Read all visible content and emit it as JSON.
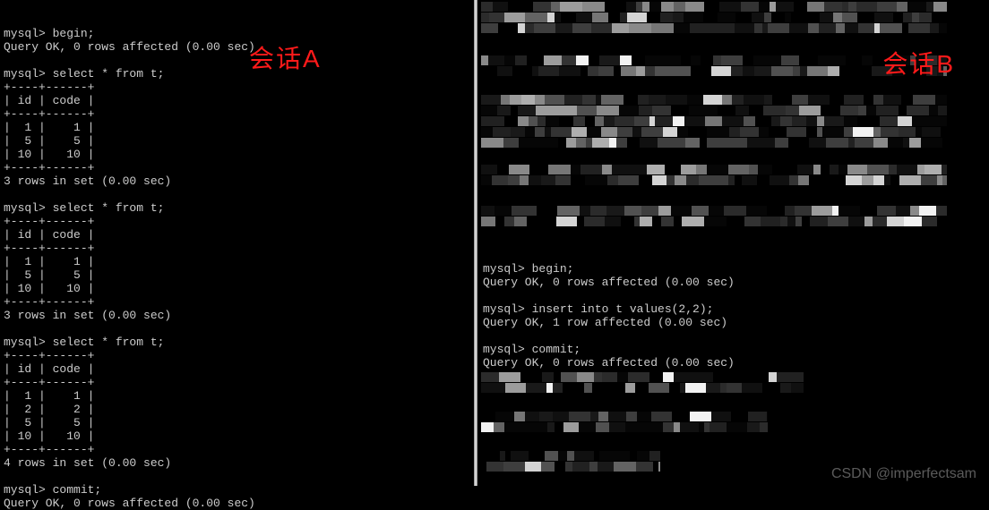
{
  "labels": {
    "sessionA": "会话A",
    "sessionB": "会话B"
  },
  "left": {
    "line1": "mysql> begin;",
    "line2": "Query OK, 0 rows affected (0.00 sec)",
    "line3": "",
    "line4": "mysql> select * from t;",
    "line5": "+----+------+",
    "line6": "| id | code |",
    "line7": "+----+------+",
    "line8": "|  1 |    1 |",
    "line9": "|  5 |    5 |",
    "line10": "| 10 |   10 |",
    "line11": "+----+------+",
    "line12": "3 rows in set (0.00 sec)",
    "line13": "",
    "line14": "mysql> select * from t;",
    "line15": "+----+------+",
    "line16": "| id | code |",
    "line17": "+----+------+",
    "line18": "|  1 |    1 |",
    "line19": "|  5 |    5 |",
    "line20": "| 10 |   10 |",
    "line21": "+----+------+",
    "line22": "3 rows in set (0.00 sec)",
    "line23": "",
    "line24": "mysql> select * from t;",
    "line25": "+----+------+",
    "line26": "| id | code |",
    "line27": "+----+------+",
    "line28": "|  1 |    1 |",
    "line29": "|  2 |    2 |",
    "line30": "|  5 |    5 |",
    "line31": "| 10 |   10 |",
    "line32": "+----+------+",
    "line33": "4 rows in set (0.00 sec)",
    "line34": "",
    "line35": "mysql> commit;",
    "line36": "Query OK, 0 rows affected (0.00 sec)"
  },
  "right": {
    "clear1": "mysql> begin;",
    "clear2": "Query OK, 0 rows affected (0.00 sec)",
    "clear3": "",
    "clear4": "mysql> insert into t values(2,2);",
    "clear5": "Query OK, 1 row affected (0.00 sec)",
    "clear6": "",
    "clear7": "mysql> commit;",
    "clear8": "Query OK, 0 rows affected (0.00 sec)"
  },
  "watermark": "CSDN @imperfectsam"
}
